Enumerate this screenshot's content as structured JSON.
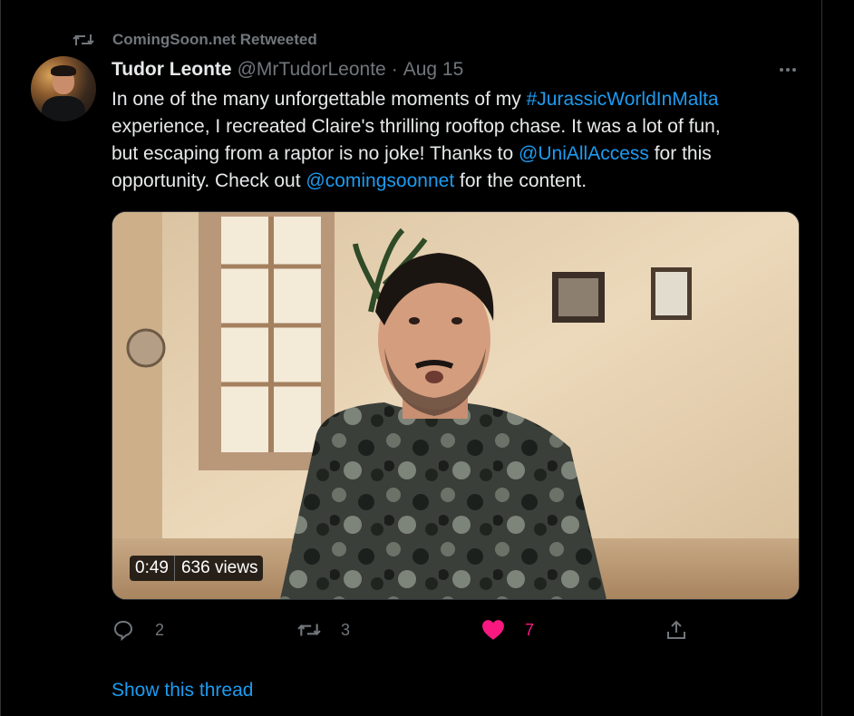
{
  "retweet": {
    "label": "ComingSoon.net Retweeted",
    "icon": "retweet-icon"
  },
  "tweet": {
    "display_name": "Tudor Leonte",
    "handle": "@MrTudorLeonte",
    "separator": "·",
    "date": "Aug 15",
    "text_lines": [
      [
        {
          "t": "In one of the many unforgettable moments of my "
        },
        {
          "t": "#JurassicWorldInMalta",
          "link": true
        }
      ],
      [
        {
          "t": "experience, I recreated Claire's thrilling rooftop chase. It was a lot of fun,"
        }
      ],
      [
        {
          "t": "but escaping from a raptor is no joke! Thanks to "
        },
        {
          "t": "@UniAllAccess",
          "link": true
        },
        {
          "t": " for this"
        }
      ],
      [
        {
          "t": "opportunity. Check out "
        },
        {
          "t": "@comingsoonnet",
          "link": true
        },
        {
          "t": " for the content."
        }
      ]
    ],
    "video": {
      "duration": "0:49",
      "views": "636 views"
    },
    "actions": {
      "reply_count": "2",
      "retweet_count": "3",
      "like_count": "7"
    },
    "show_thread": "Show this thread"
  },
  "colors": {
    "background": "#000000",
    "text": "#e7e9ea",
    "muted": "#71767b",
    "link": "#1d9bf0",
    "like": "#f91880"
  }
}
